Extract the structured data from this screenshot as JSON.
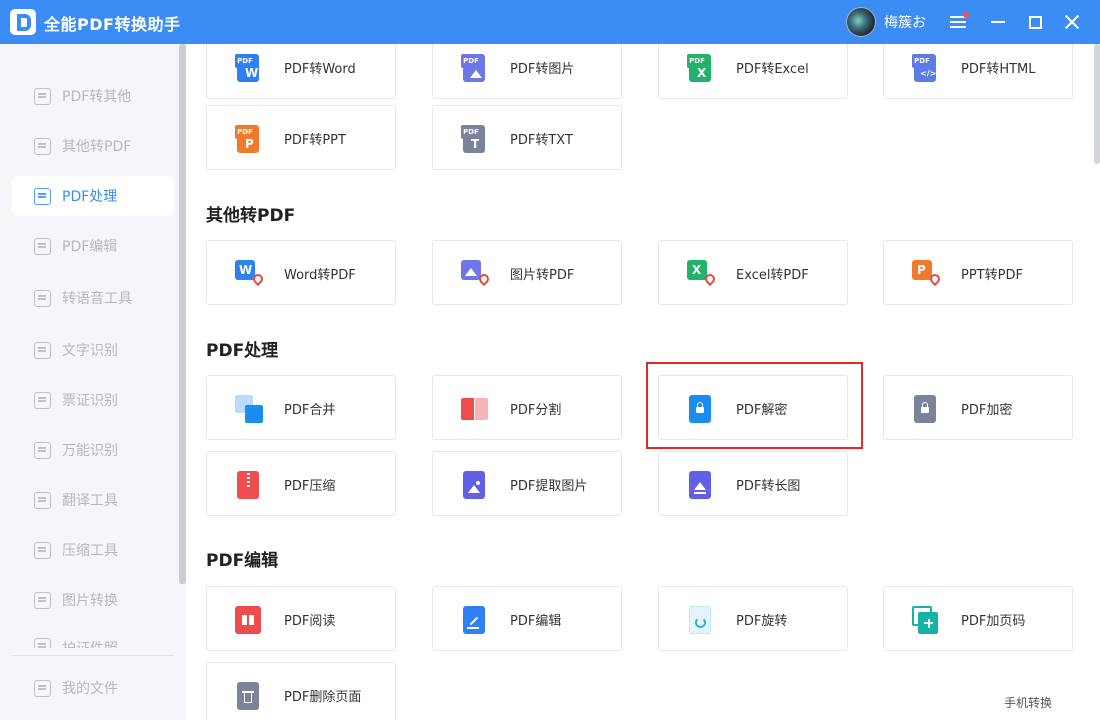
{
  "app": {
    "title": "全能PDF转换助手",
    "username": "梅簇お"
  },
  "sidebar": {
    "items": [
      {
        "label": "PDF转其他",
        "icon": "pdf-export-icon"
      },
      {
        "label": "其他转PDF",
        "icon": "pdf-import-icon"
      },
      {
        "label": "PDF处理",
        "icon": "pdf-process-icon",
        "active": true
      },
      {
        "label": "PDF编辑",
        "icon": "pdf-edit-icon"
      },
      {
        "label": "转语音工具",
        "icon": "voice-icon"
      },
      {
        "label": "文字识别",
        "icon": "ocr-icon"
      },
      {
        "label": "票证识别",
        "icon": "ticket-icon"
      },
      {
        "label": "万能识别",
        "icon": "universal-recognition-icon"
      },
      {
        "label": "翻译工具",
        "icon": "translate-icon"
      },
      {
        "label": "压缩工具",
        "icon": "compress-icon"
      },
      {
        "label": "图片转换",
        "icon": "image-convert-icon"
      },
      {
        "label": "护证件照",
        "icon": "id-photo-icon"
      }
    ],
    "my_files": "我的文件"
  },
  "sections": {
    "pdf_to_other": {
      "items": [
        {
          "label": "PDF转Word",
          "icon": "pdf-to-word-icon"
        },
        {
          "label": "PDF转图片",
          "icon": "pdf-to-image-icon"
        },
        {
          "label": "PDF转Excel",
          "icon": "pdf-to-excel-icon"
        },
        {
          "label": "PDF转HTML",
          "icon": "pdf-to-html-icon"
        },
        {
          "label": "PDF转PPT",
          "icon": "pdf-to-ppt-icon"
        },
        {
          "label": "PDF转TXT",
          "icon": "pdf-to-txt-icon"
        }
      ]
    },
    "other_to_pdf": {
      "title": "其他转PDF",
      "items": [
        {
          "label": "Word转PDF",
          "icon": "word-to-pdf-icon"
        },
        {
          "label": "图片转PDF",
          "icon": "image-to-pdf-icon"
        },
        {
          "label": "Excel转PDF",
          "icon": "excel-to-pdf-icon"
        },
        {
          "label": "PPT转PDF",
          "icon": "ppt-to-pdf-icon"
        }
      ]
    },
    "pdf_process": {
      "title": "PDF处理",
      "items": [
        {
          "label": "PDF合并",
          "icon": "merge-icon"
        },
        {
          "label": "PDF分割",
          "icon": "split-icon"
        },
        {
          "label": "PDF解密",
          "icon": "unlock-icon",
          "highlighted": true
        },
        {
          "label": "PDF加密",
          "icon": "lock-icon"
        },
        {
          "label": "PDF压缩",
          "icon": "compress-file-icon"
        },
        {
          "label": "PDF提取图片",
          "icon": "extract-image-icon"
        },
        {
          "label": "PDF转长图",
          "icon": "long-image-icon"
        }
      ]
    },
    "pdf_edit": {
      "title": "PDF编辑",
      "items": [
        {
          "label": "PDF阅读",
          "icon": "read-icon"
        },
        {
          "label": "PDF编辑",
          "icon": "edit-icon"
        },
        {
          "label": "PDF旋转",
          "icon": "rotate-icon"
        },
        {
          "label": "PDF加页码",
          "icon": "page-number-icon"
        },
        {
          "label": "PDF删除页面",
          "icon": "delete-page-icon"
        }
      ]
    }
  },
  "badges": {
    "pdf": "PDF",
    "word": "W",
    "excel": "X",
    "ppt": "P",
    "txt": "T",
    "html": "</>"
  },
  "mobile_link": "手机转换",
  "colors": {
    "titlebar": "#3b8cf5",
    "accent": "#3b8cf5",
    "highlight_border": "#e02a2a"
  }
}
